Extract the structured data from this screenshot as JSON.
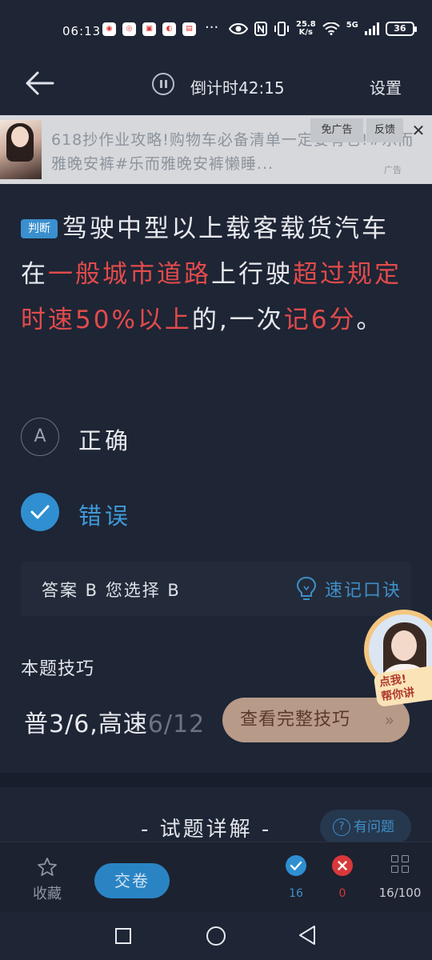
{
  "status_bar": {
    "time": "06:13",
    "more": "···",
    "net_speed_value": "25.8",
    "net_speed_unit": "K/s",
    "network": "5G",
    "battery": "36"
  },
  "nav": {
    "countdown": "倒计时42:15",
    "settings": "设置"
  },
  "ad": {
    "text": "618抄作业攻略!购物车必备清单一定要有它!#乐而雅晚安裤#乐而雅晚安裤懒睡...",
    "free_label": "免广告",
    "feedback_label": "反馈",
    "close": "✕",
    "tag": "广告"
  },
  "question": {
    "type_tag": "判断",
    "part1": "驾驶中型以上载客载货汽车在",
    "highlight1": "一般城市道路",
    "part2": "上行驶",
    "highlight2": "超过规定时速50%以上",
    "part3": "的,一次",
    "highlight3": "记6分",
    "part4": "。"
  },
  "options": [
    {
      "letter": "A",
      "text": "正确",
      "selected": false
    },
    {
      "letter": "B",
      "text": "错误",
      "selected": true
    }
  ],
  "answer": {
    "text": "答案 B  您选择 B",
    "memo_link": "速记口诀"
  },
  "tip": {
    "title": "本题技巧",
    "content_visible": "普3/6,高速",
    "content_faded": "6/12",
    "view_button": "查看完整技巧",
    "arrows": "»"
  },
  "helper": {
    "label_line1": "点我!",
    "label_line2": "帮你讲"
  },
  "detail": {
    "title": "- 试题详解 -",
    "ask_button": "有问题",
    "ask_icon": "?"
  },
  "bottom_bar": {
    "favorite_label": "收藏",
    "submit_label": "交卷",
    "correct_count": "16",
    "wrong_count": "0",
    "progress": "16/100"
  },
  "colors": {
    "background": "#1e2535",
    "accent_blue": "#2f8fd0",
    "highlight_red": "#e24b4b",
    "tip_button": "#b89a88"
  }
}
